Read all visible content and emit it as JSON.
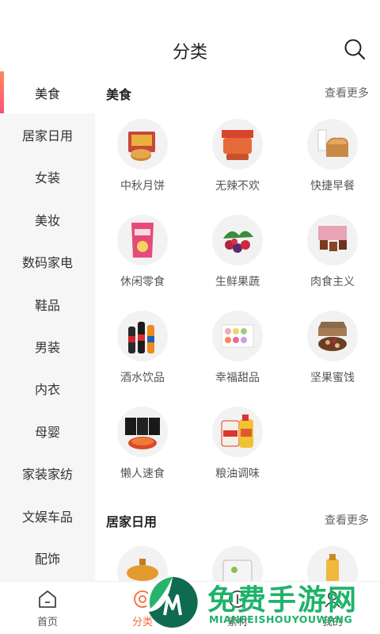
{
  "header": {
    "title": "分类"
  },
  "sidebar": {
    "items": [
      {
        "label": "美食"
      },
      {
        "label": "居家日用"
      },
      {
        "label": "女装"
      },
      {
        "label": "美妆"
      },
      {
        "label": "数码家电"
      },
      {
        "label": "鞋品"
      },
      {
        "label": "男装"
      },
      {
        "label": "内衣"
      },
      {
        "label": "母婴"
      },
      {
        "label": "家装家纺"
      },
      {
        "label": "文娱车品"
      },
      {
        "label": "配饰"
      }
    ],
    "active": "美食"
  },
  "sections": [
    {
      "title": "美食",
      "more": "查看更多",
      "items": [
        {
          "label": "中秋月饼"
        },
        {
          "label": "无辣不欢"
        },
        {
          "label": "快捷早餐"
        },
        {
          "label": "休闲零食"
        },
        {
          "label": "生鲜果蔬"
        },
        {
          "label": "肉食主义"
        },
        {
          "label": "酒水饮品"
        },
        {
          "label": "幸福甜品"
        },
        {
          "label": "坚果蜜饯"
        },
        {
          "label": "懒人速食"
        },
        {
          "label": "粮油调味"
        }
      ]
    },
    {
      "title": "居家日用",
      "more": "查看更多",
      "items": []
    }
  ],
  "bottom_nav": [
    {
      "label": "首页",
      "icon": "home-icon"
    },
    {
      "label": "分类",
      "icon": "category-icon",
      "active": true
    },
    {
      "label": "素材",
      "icon": "material-icon"
    },
    {
      "label": "我的",
      "icon": "user-icon"
    }
  ],
  "watermark": {
    "title": "免费手游网",
    "subtitle": "MIANFEISHOUYOUWANG"
  },
  "colors": {
    "accent": "#f46b3c",
    "sidebar_bg": "#f6f6f6",
    "watermark_green": "#1fb36a"
  }
}
